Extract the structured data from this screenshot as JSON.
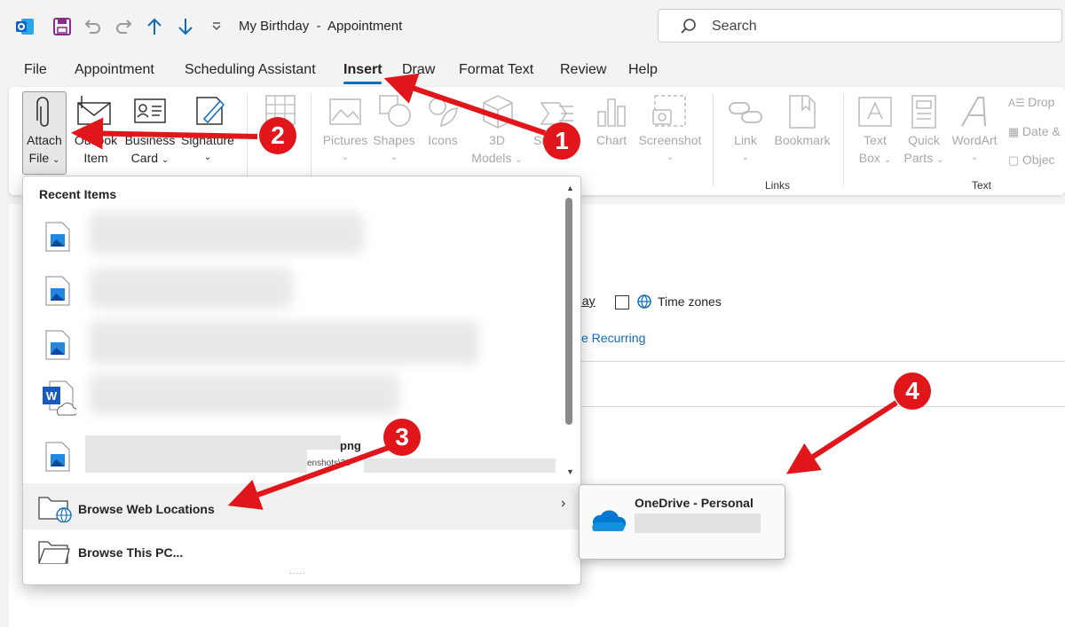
{
  "window": {
    "title": "My Birthday  -  Appointment"
  },
  "search": {
    "placeholder": "Search"
  },
  "menu": {
    "tabs": [
      "File",
      "Appointment",
      "Scheduling Assistant",
      "Insert",
      "Draw",
      "Format Text",
      "Review",
      "Help"
    ]
  },
  "ribbon": {
    "attach_file": [
      "Attach",
      "File"
    ],
    "outlook_item": [
      "Outlook",
      "Item"
    ],
    "business_card": [
      "Business",
      "Card"
    ],
    "signature": "Signature",
    "pictures": "Pictures",
    "shapes": "Shapes",
    "icons": "Icons",
    "models3d": [
      "3D",
      "Models"
    ],
    "smartart_partial": "Sr",
    "chart": "Chart",
    "screenshot": "Screenshot",
    "link": "Link",
    "bookmark": "Bookmark",
    "text_box": [
      "Text",
      "Box"
    ],
    "quick_parts": [
      "Quick",
      "Parts"
    ],
    "wordart": "WordArt",
    "drop_cap": "Drop",
    "date_time": "Date &",
    "object": "Objec",
    "groups": {
      "links": "Links",
      "text": "Text"
    }
  },
  "background": {
    "all_day_partial": "day",
    "time_zones": "Time zones",
    "make_recurring_partial": "ke Recurring"
  },
  "dropdown": {
    "header": "Recent Items",
    "visible_text": {
      "file_ext": "png",
      "path_fragment": "enshots\\20"
    },
    "browse_web": "Browse Web Locations",
    "browse_pc": "Browse This PC...",
    "more_dots": "....."
  },
  "submenu": {
    "title": "OneDrive - Personal"
  },
  "annotations": [
    "1",
    "2",
    "3",
    "4"
  ],
  "colors": {
    "accent": "#0f6cbd",
    "annotation": "#e0161b",
    "outlook_blue": "#0a64c8"
  }
}
